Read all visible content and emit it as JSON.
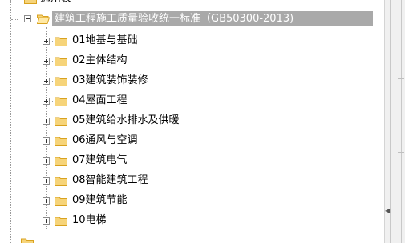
{
  "tree": {
    "partial_item_label": "通用表",
    "root": {
      "label": "建筑工程施工质量验收统一标准（GB50300-2013)",
      "expanded": true,
      "selected": true
    },
    "children": [
      {
        "label": "01地基与基础"
      },
      {
        "label": "02主体结构"
      },
      {
        "label": "03建筑装饰装修"
      },
      {
        "label": "04屋面工程"
      },
      {
        "label": "05建筑给水排水及供暖"
      },
      {
        "label": "06通风与空调"
      },
      {
        "label": "07建筑电气"
      },
      {
        "label": "08智能建筑工程"
      },
      {
        "label": "09建筑节能"
      },
      {
        "label": "10电梯"
      }
    ]
  },
  "colors": {
    "selection_bg": "#a9a9a9",
    "folder_fill": "#f6d47a",
    "folder_stroke": "#d9a21f"
  }
}
